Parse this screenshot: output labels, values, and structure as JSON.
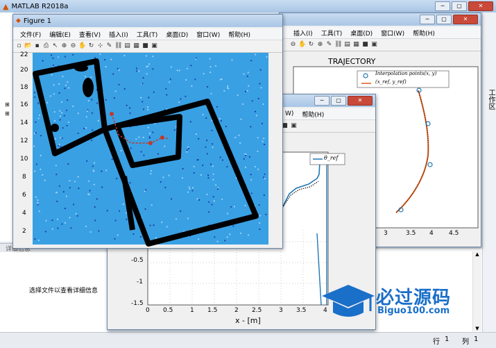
{
  "main": {
    "title": "MATLAB R2018a",
    "side_panel_label": "工作区",
    "details_label": "详细信息",
    "details_text": "选择文件以查看详细信息",
    "status_row_label": "行",
    "status_row_value": "1",
    "status_col_label": "列",
    "status_col_value": "1"
  },
  "figure1": {
    "title": "Figure 1",
    "menu": [
      "文件(F)",
      "编辑(E)",
      "查看(V)",
      "插入(I)",
      "工具(T)",
      "桌面(D)",
      "窗口(W)",
      "帮助(H)"
    ],
    "yticks": [
      "22",
      "20",
      "18",
      "16",
      "14",
      "12",
      "10",
      "8",
      "6",
      "4",
      "2"
    ]
  },
  "traj": {
    "menu": [
      "插入(I)",
      "工具(T)",
      "桌面(D)",
      "窗口(W)",
      "帮助(H)"
    ],
    "title": "TRAJECTORY",
    "legend_points": "Interpolation points(x, y)",
    "legend_ref": "(x_ref, y_ref)",
    "xticks": [
      "3",
      "3.5",
      "4",
      "4.5"
    ]
  },
  "theta": {
    "menu_tail": "W)",
    "menu_help": "帮助(H)",
    "legend": "θ_ref",
    "xlabel": "x - [m]",
    "xticks": [
      "0",
      "0.5",
      "1",
      "1.5",
      "2",
      "2.5",
      "3",
      "3.5",
      "4"
    ],
    "yticks": [
      "-0.5",
      "-1",
      "-1.5"
    ]
  },
  "watermark": {
    "chinese": "必过源码",
    "latin": "Biguo100.com"
  },
  "colors": {
    "map_blue": "#39a0e3",
    "obstacle": "#000000",
    "path_red": "#c0392b",
    "ref_orange": "#e05a1a",
    "theta_blue": "#1f77b4"
  }
}
